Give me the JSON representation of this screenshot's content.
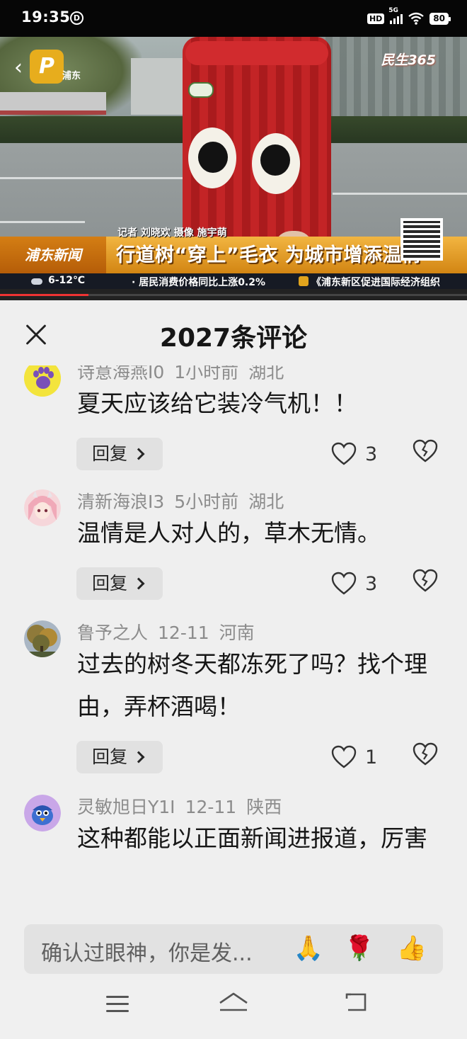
{
  "status_bar": {
    "time": "19:35",
    "app_icon": "D",
    "hd": "HD",
    "network": "5G",
    "battery": "80"
  },
  "video": {
    "back_icon": "back-chevron-icon",
    "logo_letter": "P",
    "logo_text": "浦东",
    "channel_logo": "民生365",
    "credit": "记者 刘晓欢 摄像 施宇萌",
    "program_name": "浦东新闻",
    "headline": "行道树“穿上”毛衣 为城市增添温情",
    "ticker_weather": "6-12℃",
    "ticker_item_1": "· 居民消费价格同比上涨0.2%",
    "ticker_item_2": "《浦东新区促进国际经济组织",
    "progress": 0.19,
    "accent_color": "#e7ad1d"
  },
  "comments_panel": {
    "title": "2027条评论",
    "close_icon": "close-icon",
    "reply_label": "回复",
    "comments": [
      {
        "author": "诗意海燕I0",
        "time": "1小时前",
        "location": "湖北",
        "text": "夏天应该给它装冷气机！！",
        "likes": "3",
        "avatar": "paw-avatar"
      },
      {
        "author": "清新海浪I3",
        "time": "5小时前",
        "location": "湖北",
        "text": "温情是人对人的，草木无情。",
        "likes": "3",
        "avatar": "anime-girl-avatar"
      },
      {
        "author": "鲁予之人",
        "time": "12-11",
        "location": "河南",
        "text": "过去的树冬天都冻死了吗？找个理由，弄杯酒喝！",
        "likes": "1",
        "avatar": "tree-photo-avatar"
      },
      {
        "author": "灵敏旭日Y1I",
        "time": "12-11",
        "location": "陕西",
        "text": "这种都能以正面新闻进报道，厉害",
        "likes": "",
        "avatar": "bird-avatar"
      }
    ]
  },
  "input_bar": {
    "placeholder": "确认过眼神，你是发...",
    "emojis": [
      "🙏",
      "🌹",
      "👍"
    ]
  },
  "nav_bar": {
    "menu_icon": "menu-icon",
    "home_icon": "home-icon",
    "back_icon": "back-icon"
  }
}
